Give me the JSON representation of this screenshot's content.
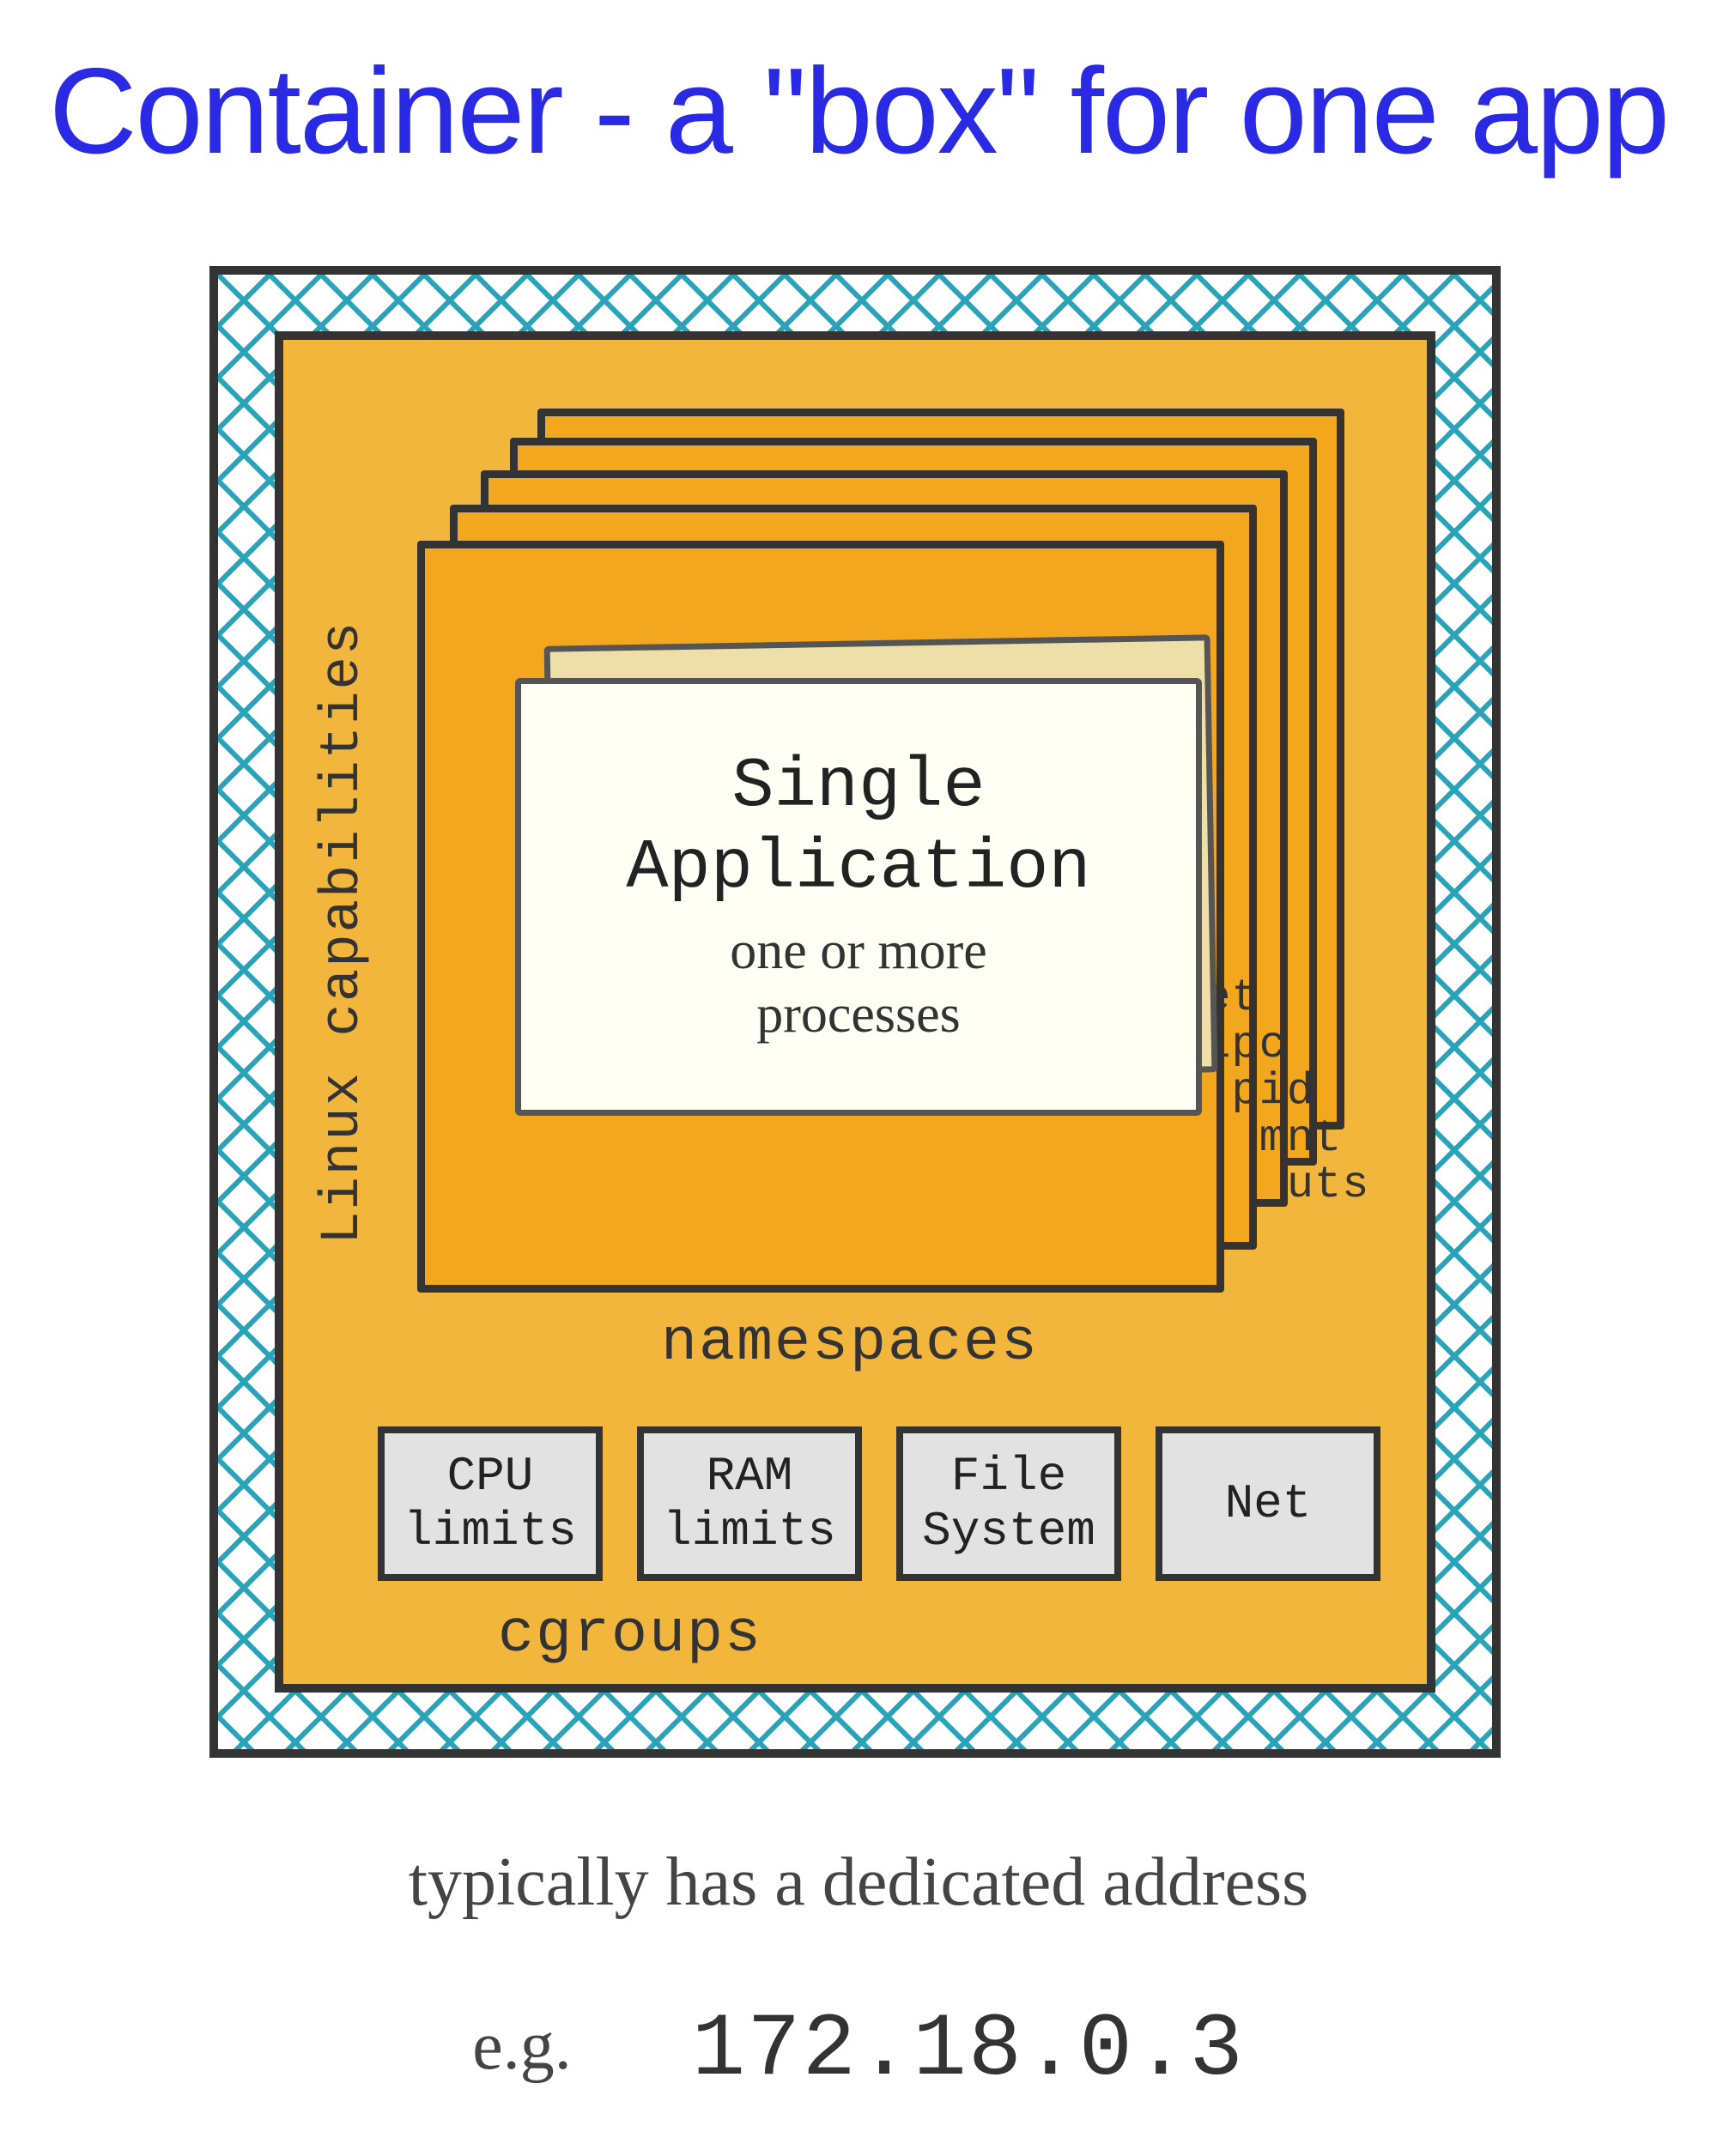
{
  "title": "Container - a \"box\" for one app",
  "linux_caps_label": "Linux capabilities",
  "app": {
    "title": "Single\nApplication",
    "subtitle": "one or more\nprocesses"
  },
  "namespace_list": [
    "net",
    "ipc",
    "pid",
    "mnt",
    "uts"
  ],
  "namespaces_label": "namespaces",
  "cgroups": {
    "items": [
      "CPU\nlimits",
      "RAM\nlimits",
      "File\nSystem",
      "Net"
    ],
    "label": "cgroups"
  },
  "footer": {
    "line1": "typically has a dedicated address",
    "eg_label": "e.g.",
    "ip": "172.18.0.3"
  },
  "colors": {
    "title_blue": "#2a2ae5",
    "orange_fill": "#f3b63c",
    "orange_dark": "#f3a71e",
    "hatch_teal": "#2aa3b8"
  }
}
